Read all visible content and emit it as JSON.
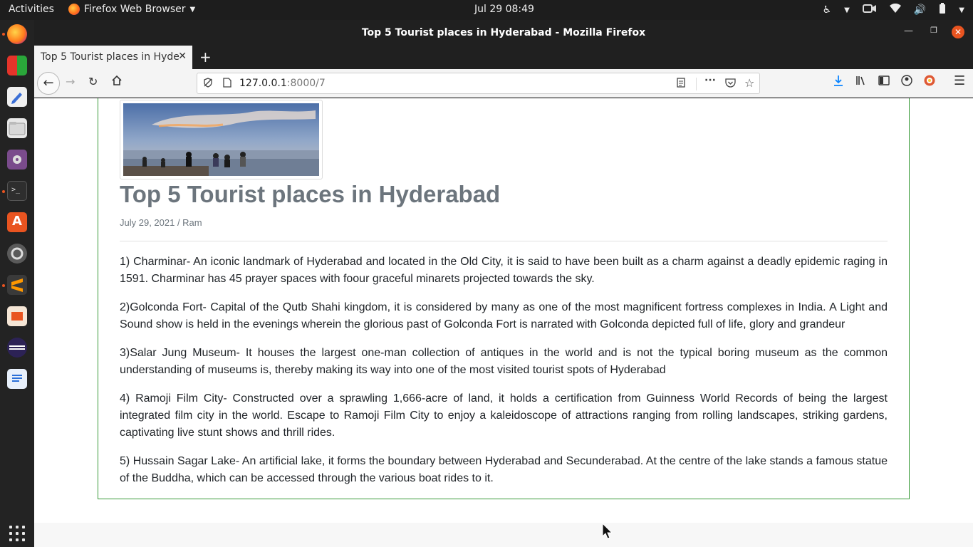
{
  "topbar": {
    "activities": "Activities",
    "app_name": "Firefox Web Browser",
    "clock": "Jul 29  08:49"
  },
  "window": {
    "title": "Top 5 Tourist places in Hyderabad - Mozilla Firefox"
  },
  "tabs": [
    {
      "label": "Top 5 Tourist places in Hyde"
    }
  ],
  "urlbar": {
    "host": "127.0.0.1",
    "path": ":8000/7"
  },
  "post": {
    "title": "Top 5 Tourist places in Hyderabad",
    "meta": "July 29, 2021 / Ram",
    "paragraphs": [
      "1) Charminar- An iconic landmark of Hyderabad and located in the Old City, it is said to have been built as a charm against a deadly epidemic raging in 1591. Charminar has 45 prayer spaces with foour graceful minarets projected towards the sky.",
      "2)Golconda Fort- Capital of the Qutb Shahi kingdom, it is considered by many as one of the most magnificent fortress complexes in India. A Light and Sound show is held in the evenings wherein the glorious past of Golconda Fort is narrated with Golconda depicted full of life, glory and grandeur",
      "3)Salar Jung Museum- It houses the largest one-man collection of antiques in the world and is not the typical boring museum as the common understanding of museums is, thereby making its way into one of the most visited tourist spots of Hyderabad",
      "4) Ramoji Film City- Constructed over a sprawling 1,666-acre of land, it holds a certification from Guinness World Records of being the largest integrated film city in the world. Escape to Ramoji Film City to enjoy a kaleidoscope of attractions ranging from rolling landscapes, striking gardens, captivating live stunt shows and thrill rides.",
      "5) Hussain Sagar Lake- An artificial lake, it forms the boundary between Hyderabad and Secunderabad. At the centre of the lake stands a famous statue of the Buddha, which can be accessed through the various boat rides to it."
    ]
  },
  "colors": {
    "ubuntu_orange": "#e95420",
    "card_border": "#3a9a3a",
    "title_gray": "#6c757d",
    "download_blue": "#0a84ff"
  },
  "dock_icons": [
    "firefox-icon",
    "office-suite-icon",
    "text-editor-icon",
    "files-icon",
    "video-player-icon",
    "terminal-icon",
    "software-center-icon",
    "settings-icon",
    "sublime-text-icon",
    "presentation-icon",
    "eclipse-icon",
    "writer-icon",
    "app-grid-icon"
  ]
}
